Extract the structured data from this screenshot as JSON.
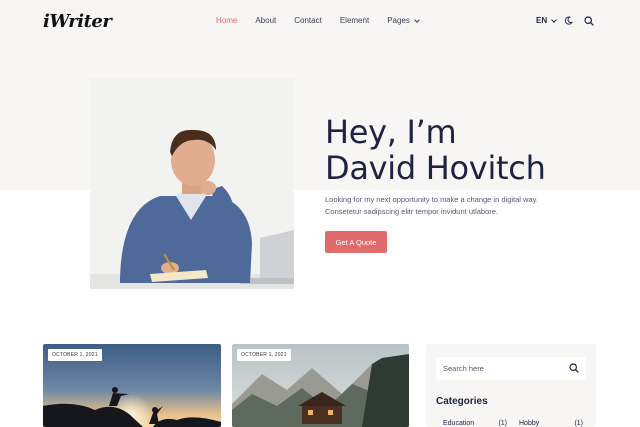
{
  "header": {
    "logo": "iWriter",
    "nav": [
      {
        "label": "Home",
        "active": true
      },
      {
        "label": "About"
      },
      {
        "label": "Contact"
      },
      {
        "label": "Element"
      },
      {
        "label": "Pages",
        "dropdown": true
      }
    ],
    "language": "EN",
    "icons": [
      "moon-icon",
      "search-icon"
    ]
  },
  "hero": {
    "title_line1": "Hey, I’m",
    "title_line2": "David Hovitch",
    "desc_line1": "Looking for my next opportunity to make a change in digital way.",
    "desc_line2": "Consetetur sadipscing elitr tempor invidunt utlabore.",
    "button": "Get A Quote"
  },
  "posts": [
    {
      "date": "OCTOBER 1, 2021"
    },
    {
      "date": "OCTOBER 1, 2021"
    }
  ],
  "sidebar": {
    "search_placeholder": "Search here",
    "categories_title": "Categories",
    "categories": [
      {
        "name": "Education",
        "count": "(1)"
      },
      {
        "name": "Hobby",
        "count": "(1)"
      }
    ]
  },
  "colors": {
    "accent": "#e06b6b",
    "text": "#1f2340",
    "hero_bg": "#f7f6f4"
  }
}
